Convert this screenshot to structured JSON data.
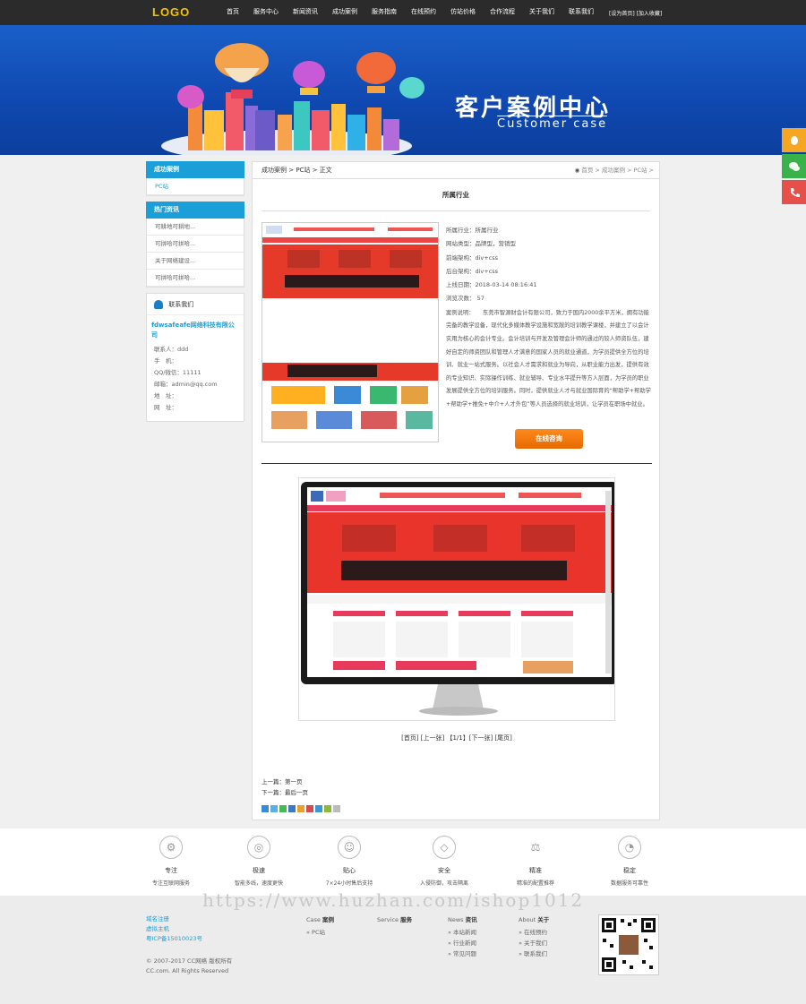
{
  "header": {
    "logo": "LOGO",
    "nav": [
      "首页",
      "服务中心",
      "新闻资讯",
      "成功案例",
      "服务指南",
      "在线预约",
      "仿站价格",
      "合作流程",
      "关于我们",
      "联系我们"
    ],
    "top_links": "[设为首页] [加入收藏]"
  },
  "banner": {
    "title": "客户案例中心",
    "subtitle": "Customer case"
  },
  "left": {
    "cases_title": "成功案例",
    "cases_items": [
      "PC站"
    ],
    "news_title": "热门资讯",
    "news_items": [
      "可耕地可耕地...",
      "可拼哈可拼哈...",
      "关于网络建设...",
      "可拼哈可拼哈..."
    ],
    "contact_title": "联系我们",
    "company": "fdwsafeafe网络科技有限公司",
    "contact_rows": [
      "联系人：ddd",
      "手　机：",
      "QQ/微信：11111",
      "邮箱：admin@qq.com",
      "地　址：",
      "网　址："
    ]
  },
  "main": {
    "crumb_left": "成功案例 > PC站 > 正文",
    "crumb_right": "首页 > 成功案例 > PC站 >",
    "page_title": "所属行业",
    "info_rows": [
      "所属行业：所属行业",
      "网站类型：品牌型，营销型",
      "前端架构：div+css",
      "后台架构：div+css",
      "上线日期：2018-03-14 08:16:41",
      "浏览次数： 57"
    ],
    "desc": "案例说明：　　东莞市智源财会计有限公司，致力于国内2000余平方米，拥有功能完备的教学设备，现代化多媒体教学设施和宽敞的培训教学课楼，并建立了以会计实用为核心的会计专业。会计培训与开发及管理会计师的通过的较人师资队伍，建好自定的师资团队和管理人才满意的国家人员的就业通道，为学员提供全方位的培训、就业一站式服务。以社会人才需求和就业为导向，从职业能力出发，提供有效的专业知识、实际操作训练、就业辅导、专业水平提升等方人层面，为学员的职业发展提供全方位的培训服务。同时，提供就业人才与就业国际育的“帮助学+帮助学+帮助学+推免+中介+人才外包”等人员选择的就业培训，让学员在职场中就业。",
    "button": "在线咨询",
    "pager": "[首页] [上一张] 【1/1】[下一张] [尾页]",
    "prev": "上一篇：第一页",
    "next": "下一篇：最后一页"
  },
  "features": [
    {
      "title": "专注",
      "sub": "专注互联网服务"
    },
    {
      "title": "极速",
      "sub": "智能多线，速度更快"
    },
    {
      "title": "贴心",
      "sub": "7×24小时售后支持"
    },
    {
      "title": "安全",
      "sub": "入侵防御，攻击隔离"
    },
    {
      "title": "精准",
      "sub": "精准的配置推荐"
    },
    {
      "title": "稳定",
      "sub": "数据服务可靠性"
    }
  ],
  "watermark": "https://www.huzhan.com/ishop1012",
  "footer": {
    "links": [
      "域名注册",
      "虚拟主机",
      "粤ICP备15010023号"
    ],
    "cols": [
      {
        "h1": "Case",
        "h2": "案例",
        "items": [
          "PC站"
        ]
      },
      {
        "h1": "Service",
        "h2": "服务",
        "items": []
      },
      {
        "h1": "News",
        "h2": "资讯",
        "items": [
          "本站新闻",
          "行业新闻",
          "常见问题"
        ]
      },
      {
        "h1": "About",
        "h2": "关于",
        "items": [
          "在线预约",
          "关于我们",
          "联系我们"
        ]
      }
    ],
    "copy1": "© 2007-2017 CC网络 版权所有",
    "copy2": "CC.com. All Rights Reserved"
  },
  "colors": {
    "accent": "#1a9fd8",
    "orange": "#f07a10",
    "banner": "#1558c0",
    "topbar": "#2b2b2b"
  }
}
